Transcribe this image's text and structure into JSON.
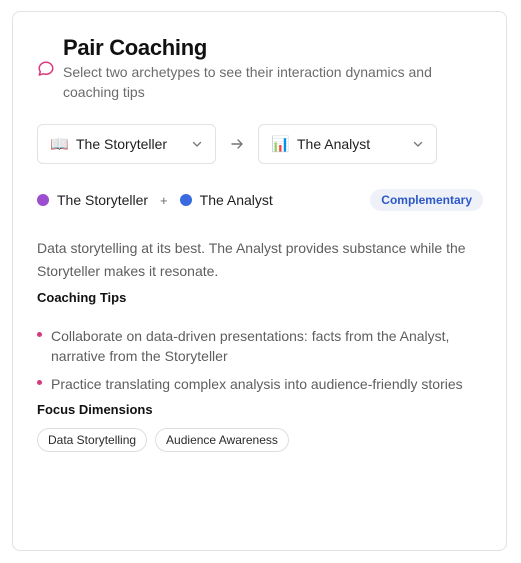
{
  "header": {
    "title": "Pair Coaching",
    "subtitle": "Select two archetypes to see their interaction dynamics and coaching tips"
  },
  "selectors": {
    "first": {
      "emoji": "📖",
      "label": "The Storyteller"
    },
    "second": {
      "emoji": "📊",
      "label": "The Analyst"
    }
  },
  "pair": {
    "first_name": "The Storyteller",
    "first_color": "#9b4fd0",
    "plus": "+",
    "second_name": "The Analyst",
    "second_color": "#3b6ae0",
    "badge": "Complementary"
  },
  "description": "Data storytelling at its best. The Analyst provides substance while the Storyteller makes it resonate.",
  "coaching_tips": {
    "title": "Coaching Tips",
    "items": [
      "Collaborate on data-driven presentations: facts from the Analyst, narrative from the Storyteller",
      "Practice translating complex analysis into audience-friendly stories"
    ]
  },
  "focus_dimensions": {
    "title": "Focus Dimensions",
    "items": [
      "Data Storytelling",
      "Audience Awareness"
    ]
  },
  "colors": {
    "accent_pink": "#d63a7a",
    "badge_text": "#2b57c9"
  }
}
